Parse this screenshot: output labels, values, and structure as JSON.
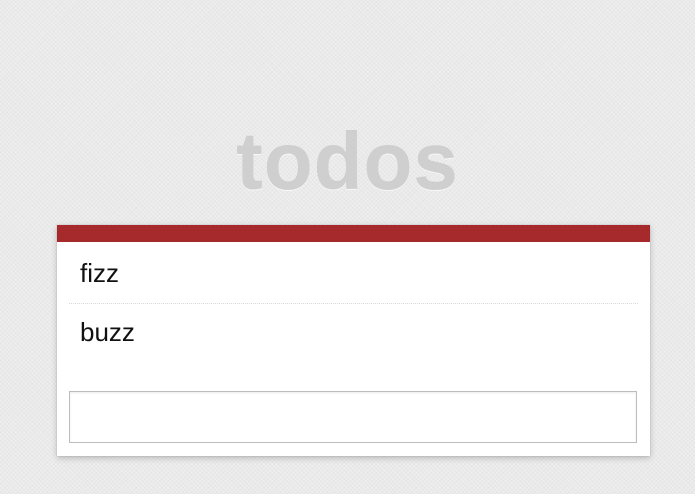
{
  "app": {
    "title": "todos"
  },
  "colors": {
    "accent": "#a62a2b",
    "background": "#eaeaea",
    "title": "#cfcfcf"
  },
  "todos": [
    {
      "label": "fizz"
    },
    {
      "label": "buzz"
    }
  ],
  "new_todo": {
    "value": "",
    "placeholder": ""
  }
}
